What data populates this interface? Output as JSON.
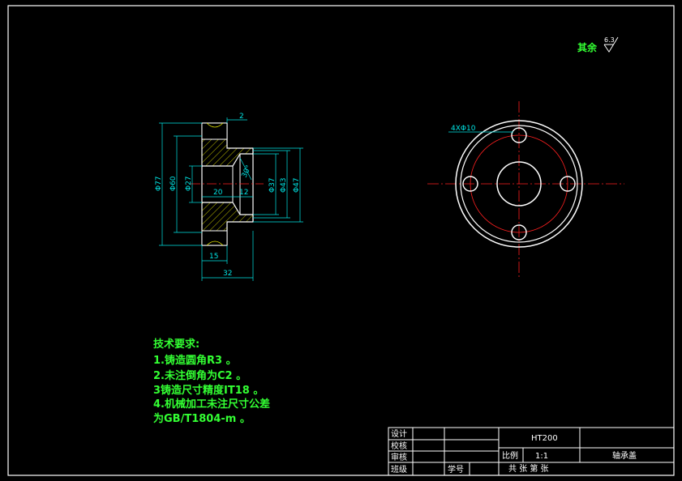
{
  "drawing_title": "轴承盖",
  "roughness_note": {
    "label": "其余",
    "value": "6.3"
  },
  "section_view": {
    "dimensions": {
      "d77": "Φ77",
      "d60": "Φ60",
      "d27": "Φ27",
      "d37": "Φ37",
      "d43": "Φ43",
      "d47": "Φ47",
      "l2": "2",
      "l20": "20",
      "l12": "12",
      "l15": "15",
      "l32": "32",
      "angle": "30°"
    }
  },
  "front_view": {
    "hole_callout": "4XΦ10"
  },
  "tech_requirements": {
    "heading": "技术要求:",
    "items": [
      "1.铸造圆角R3 。",
      "2.未注倒角为C2 。",
      "3铸造尺寸精度IT18 。",
      "4.机械加工未注尺寸公差",
      "为GB/T1804-m 。"
    ]
  },
  "title_block": {
    "design": "设计",
    "check": "校核",
    "review": "审核",
    "class": "班级",
    "student_no": "学号",
    "material": "HT200",
    "scale_label": "比例",
    "scale_value": "1:1",
    "part_name": "轴承盖",
    "sheets": "共  张  第  张"
  },
  "colors": {
    "background": "#000000",
    "outline": "#ffffff",
    "dimension": "#00e5e5",
    "hatch": "#e5e500",
    "centerline": "#ff2020",
    "text_green": "#33ff33"
  }
}
